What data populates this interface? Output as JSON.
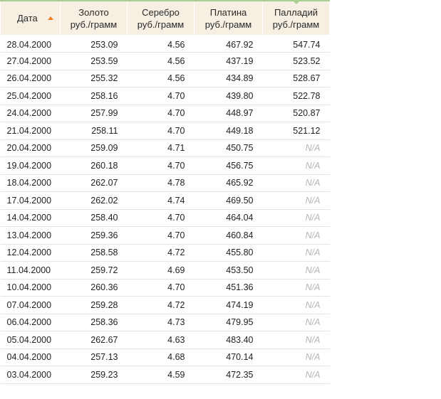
{
  "table": {
    "columns": [
      {
        "line1": "Дата",
        "line2": ""
      },
      {
        "line1": "Золото",
        "line2": "руб./грамм"
      },
      {
        "line1": "Серебро",
        "line2": "руб./грамм"
      },
      {
        "line1": "Платина",
        "line2": "руб./грамм"
      },
      {
        "line1": "Палладий",
        "line2": "руб./грамм"
      }
    ],
    "sort_column": "Дата",
    "sort_direction": "ascending-arrow",
    "accent_color": "#a8cf8f",
    "sort_icon_color": "#f07c1e",
    "header_bg": "#f6efe2",
    "rows": [
      [
        "28.04.2000",
        "253.09",
        "4.56",
        "467.92",
        "547.74"
      ],
      [
        "27.04.2000",
        "253.59",
        "4.56",
        "437.19",
        "523.52"
      ],
      [
        "26.04.2000",
        "255.32",
        "4.56",
        "434.89",
        "528.67"
      ],
      [
        "25.04.2000",
        "258.16",
        "4.70",
        "439.80",
        "522.78"
      ],
      [
        "24.04.2000",
        "257.99",
        "4.70",
        "448.97",
        "520.87"
      ],
      [
        "21.04.2000",
        "258.11",
        "4.70",
        "449.18",
        "521.12"
      ],
      [
        "20.04.2000",
        "259.09",
        "4.71",
        "450.75",
        "N/A"
      ],
      [
        "19.04.2000",
        "260.18",
        "4.70",
        "456.75",
        "N/A"
      ],
      [
        "18.04.2000",
        "262.07",
        "4.78",
        "465.92",
        "N/A"
      ],
      [
        "17.04.2000",
        "262.02",
        "4.74",
        "469.50",
        "N/A"
      ],
      [
        "14.04.2000",
        "258.40",
        "4.70",
        "464.04",
        "N/A"
      ],
      [
        "13.04.2000",
        "259.36",
        "4.70",
        "460.84",
        "N/A"
      ],
      [
        "12.04.2000",
        "258.58",
        "4.72",
        "455.80",
        "N/A"
      ],
      [
        "11.04.2000",
        "259.72",
        "4.69",
        "453.50",
        "N/A"
      ],
      [
        "10.04.2000",
        "260.36",
        "4.70",
        "451.36",
        "N/A"
      ],
      [
        "07.04.2000",
        "259.28",
        "4.72",
        "474.19",
        "N/A"
      ],
      [
        "06.04.2000",
        "258.36",
        "4.73",
        "479.95",
        "N/A"
      ],
      [
        "05.04.2000",
        "262.67",
        "4.63",
        "483.40",
        "N/A"
      ],
      [
        "04.04.2000",
        "257.13",
        "4.68",
        "470.14",
        "N/A"
      ],
      [
        "03.04.2000",
        "259.23",
        "4.59",
        "472.35",
        "N/A"
      ]
    ]
  }
}
